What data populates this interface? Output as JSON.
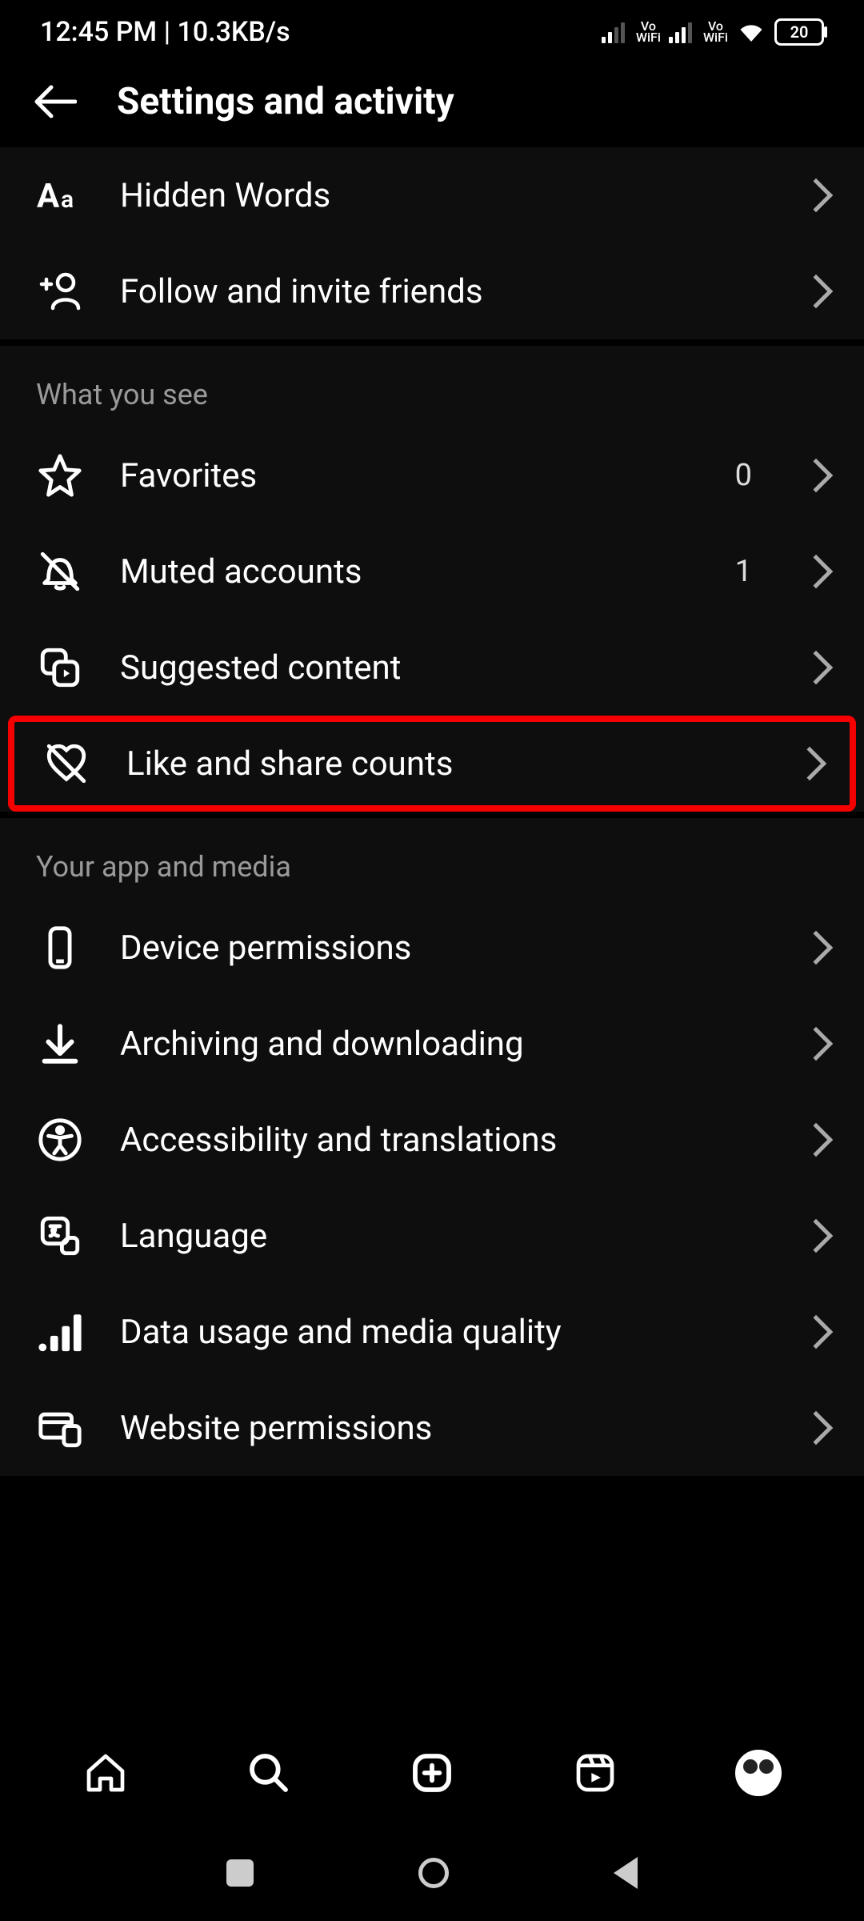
{
  "status": {
    "time": "12:45 PM | 10.3KB/s",
    "battery": "20"
  },
  "header": {
    "title": "Settings and activity"
  },
  "top_rows": [
    {
      "icon": "aa-icon",
      "label": "Hidden Words"
    },
    {
      "icon": "add-friend-icon",
      "label": "Follow and invite friends"
    }
  ],
  "section_what_you_see": {
    "title": "What you see",
    "rows": [
      {
        "icon": "star-icon",
        "label": "Favorites",
        "value": "0"
      },
      {
        "icon": "bell-off-icon",
        "label": "Muted accounts",
        "value": "1"
      },
      {
        "icon": "suggested-icon",
        "label": "Suggested content"
      },
      {
        "icon": "heart-off-icon",
        "label": "Like and share counts",
        "highlight": true
      }
    ]
  },
  "section_app_media": {
    "title": "Your app and media",
    "rows": [
      {
        "icon": "phone-icon",
        "label": "Device permissions"
      },
      {
        "icon": "download-icon",
        "label": "Archiving and downloading"
      },
      {
        "icon": "accessibility-icon",
        "label": "Accessibility and translations"
      },
      {
        "icon": "language-icon",
        "label": "Language"
      },
      {
        "icon": "signal-bars-icon",
        "label": "Data usage and media quality"
      },
      {
        "icon": "website-icon",
        "label": "Website permissions"
      }
    ]
  }
}
